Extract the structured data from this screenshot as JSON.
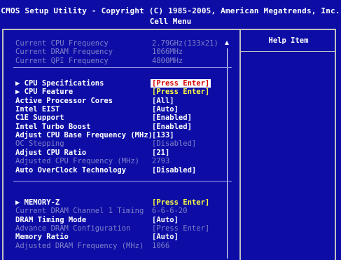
{
  "header": {
    "title": "CMOS Setup Utility - Copyright (C) 1985-2005, American Megatrends, Inc.",
    "subtitle": "Cell Menu"
  },
  "help": {
    "title": "Help Item"
  },
  "info_rows": [
    {
      "label": "Current CPU Frequency",
      "value": "2.79GHz(133x21)"
    },
    {
      "label": "Current DRAM Frequency",
      "value": "1066MHz"
    },
    {
      "label": "Current QPI Frequency",
      "value": "4800MHz"
    }
  ],
  "cpu_rows": [
    {
      "label": "▶ CPU Specifications",
      "value": "[Press Enter]",
      "state": "selected"
    },
    {
      "label": "▶ CPU Feature",
      "value": "[Press Enter]",
      "state": "submenu"
    },
    {
      "label": "Active Processor Cores",
      "value": "[All]",
      "state": "normal"
    },
    {
      "label": "Intel EIST",
      "value": "[Auto]",
      "state": "normal"
    },
    {
      "label": "C1E Support",
      "value": "[Enabled]",
      "state": "normal"
    },
    {
      "label": "Intel Turbo Boost",
      "value": "[Enabled]",
      "state": "normal"
    },
    {
      "label": "Adjust CPU Base Frequency (MHz)",
      "value": "[133]",
      "state": "normal"
    },
    {
      "label": "OC Stepping",
      "value": "[Disabled]",
      "state": "disabled"
    },
    {
      "label": "Adjust CPU Ratio",
      "value": "[21]",
      "state": "normal"
    },
    {
      "label": "Adjusted CPU Frequency (MHz)",
      "value": "2793",
      "state": "disabled"
    },
    {
      "label": "Auto OverClock Technology",
      "value": "[Disabled]",
      "state": "normal"
    }
  ],
  "memory_rows": [
    {
      "label": "▶ MEMORY-Z",
      "value": "[Press Enter]",
      "state": "submenu"
    },
    {
      "label": "Current DRAM Channel 1 Timing",
      "value": "6-6-6-20",
      "state": "disabled"
    },
    {
      "label": "DRAM Timing Mode",
      "value": "[Auto]",
      "state": "normal"
    },
    {
      "label": "  Advance DRAM Configuration",
      "value": "[Press Enter]",
      "state": "disabled"
    },
    {
      "label": "Memory Ratio",
      "value": "[Auto]",
      "state": "normal"
    },
    {
      "label": "Adjusted DRAM Frequency (MHz)",
      "value": "1066",
      "state": "disabled"
    }
  ],
  "colors": {
    "background": "#0d0da6",
    "text": "#ffffff",
    "disabled": "#7f7fc8",
    "submenu_value": "#ffff3f",
    "selected_value_fg": "#d40000",
    "selected_value_bg": "#ffffff"
  }
}
